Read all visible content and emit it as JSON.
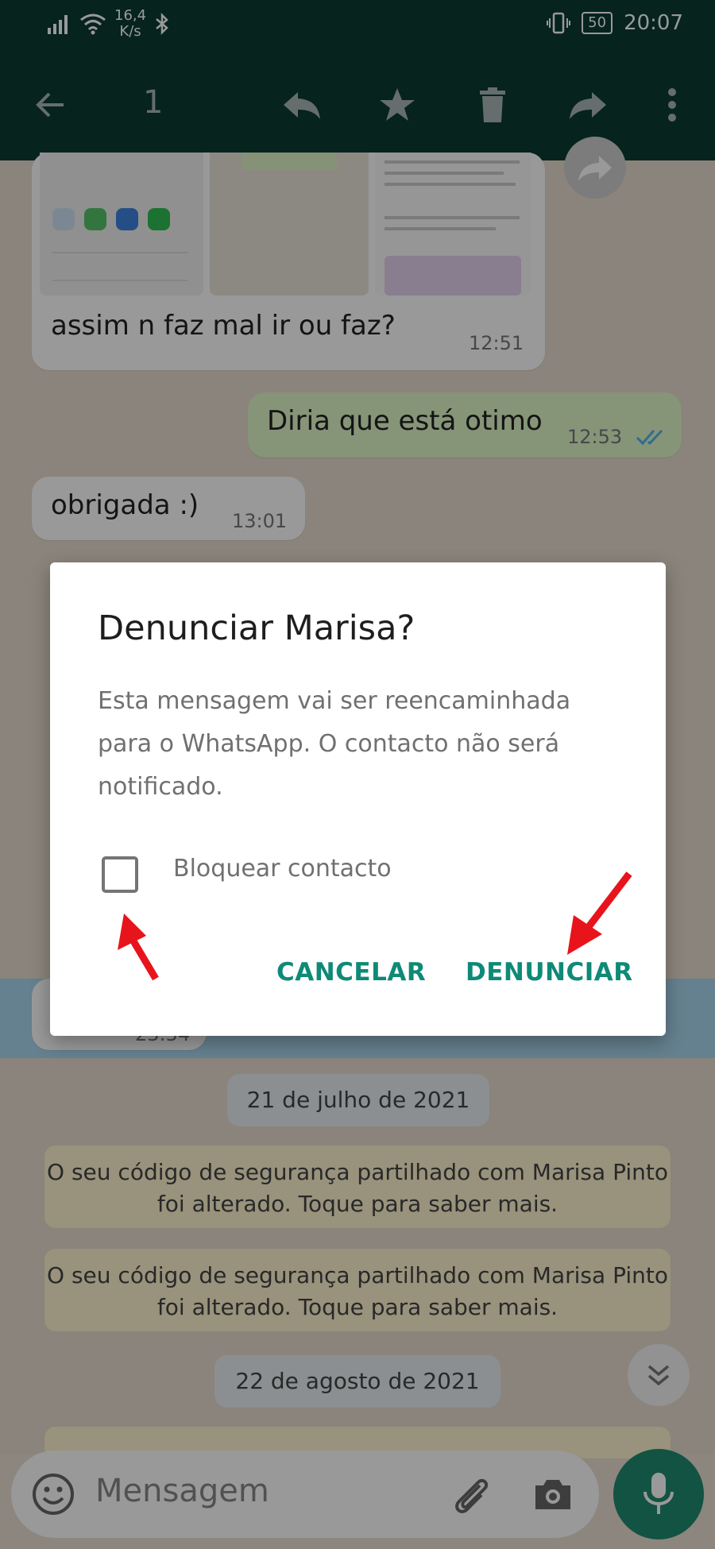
{
  "status_bar": {
    "speed_value": "16,4",
    "speed_unit": "K/s",
    "battery": "50",
    "time": "20:07"
  },
  "toolbar": {
    "selected_count": "1"
  },
  "chat": {
    "msg_received_1": {
      "text": "assim n faz mal ir ou faz?",
      "time": "12:51"
    },
    "msg_sent_1": {
      "text": "Diria que está otimo",
      "time": "12:53"
    },
    "msg_received_2": {
      "text": "obrigada :)",
      "time": "13:01"
    },
    "hidden_time": "23:54",
    "date_1": "21 de julho de 2021",
    "system_msg_1": "O seu código de segurança partilhado com Marisa Pinto foi alterado. Toque para saber mais.",
    "system_msg_2": "O seu código de segurança partilhado com Marisa Pinto foi alterado. Toque para saber mais.",
    "date_2": "22 de agosto de 2021"
  },
  "dialog": {
    "title": "Denunciar Marisa?",
    "body": "Esta mensagem vai ser reencaminhada para o WhatsApp. O contacto não será notificado.",
    "checkbox_label": "Bloquear contacto",
    "checkbox_checked": false,
    "cancel_label": "CANCELAR",
    "report_label": "DENUNCIAR"
  },
  "composer": {
    "placeholder": "Mensagem"
  },
  "colors": {
    "toolbar": "#0a3b33",
    "accent": "#0e8a77",
    "annotation_arrow": "#e8141c",
    "mic": "#1f8a70"
  }
}
